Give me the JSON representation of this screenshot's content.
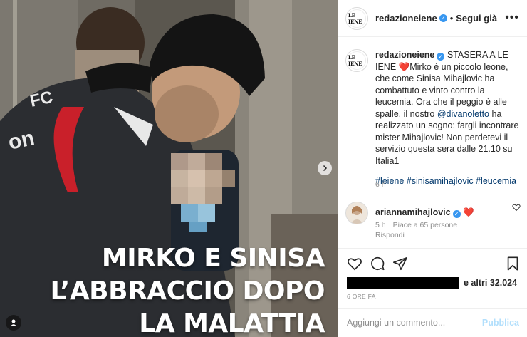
{
  "post": {
    "account": "redazioneiene",
    "logo_text": "LE IENE",
    "follow_separator": "•",
    "follow_label": "Segui già",
    "more_label": "•••",
    "overlay_lines": [
      "MIRKO E SINISA",
      "L’ABBRACCIO DOPO",
      "LA MALATTIA"
    ],
    "shirt_text": "FC"
  },
  "caption": {
    "username": "redazioneiene",
    "text_before_mention": "STASERA A LE IENE ❤️Mirko è un piccolo leone, che come Sinisa Mihajlovic ha combattuto e vinto contro la leucemia. Ora che il peggio è alle spalle, il nostro ",
    "mention": "@divanoletto",
    "text_after_mention": " ha realizzato un sogno: fargli incontrare mister Mihajlovic! Non perdetevi il servizio questa sera dalle 21.10 su Italia1",
    "hashtags": [
      "#leiene",
      "#sinisamihajlovic",
      "#leucemia"
    ],
    "age": "6 h"
  },
  "comment": {
    "username": "ariannamihajlovic",
    "text": "❤️",
    "age": "5 h",
    "likes": "Piace a 65 persone",
    "reply_label": "Rispondi"
  },
  "likes": {
    "suffix": "e altri 32.024"
  },
  "timestamp": "6 ORE FA",
  "composer": {
    "placeholder": "Aggiungi un commento...",
    "publish_label": "Pubblica"
  },
  "colors": {
    "link": "#00376b",
    "verified": "#3897f0",
    "publish_disabled": "#b2dffc",
    "muted": "#8e8e8e"
  }
}
